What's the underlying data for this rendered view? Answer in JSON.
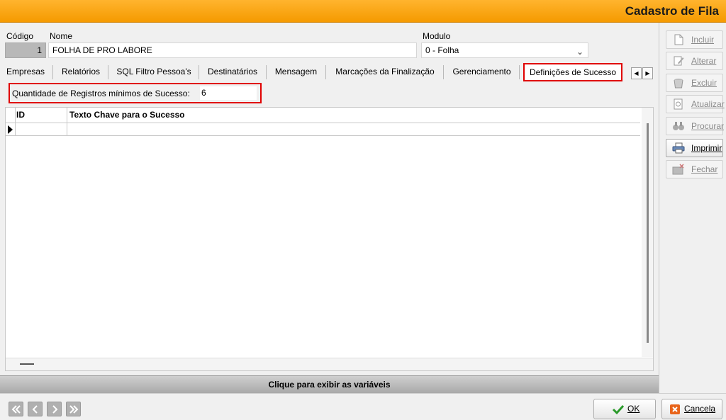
{
  "window": {
    "title": "Cadastro de Fila"
  },
  "form": {
    "codigo_label": "Código",
    "codigo_value": "1",
    "nome_label": "Nome",
    "nome_value": "FOLHA DE PRO LABORE",
    "modulo_label": "Modulo",
    "modulo_value": "0 - Folha"
  },
  "tabs": [
    {
      "label": "Empresas"
    },
    {
      "label": "Relatórios"
    },
    {
      "label": "SQL Filtro Pessoa's"
    },
    {
      "label": "Destinatários"
    },
    {
      "label": "Mensagem"
    },
    {
      "label": "Marcações da Finalização"
    },
    {
      "label": "Gerenciamento"
    },
    {
      "label": "Definições de Sucesso",
      "active": true
    }
  ],
  "success": {
    "qty_label": "Quantidade de Registros mínimos de Sucesso:",
    "qty_value": "6"
  },
  "grid": {
    "columns": [
      "ID",
      "Texto Chave para o Sucesso"
    ],
    "rows": []
  },
  "variables_bar": "Clique para exibir as variáveis",
  "sidebar": {
    "buttons": [
      {
        "label": "Incluir",
        "icon": "document-icon",
        "enabled": false
      },
      {
        "label": "Alterar",
        "icon": "edit-icon",
        "enabled": false
      },
      {
        "label": "Excluir",
        "icon": "trash-icon",
        "enabled": false
      },
      {
        "label": "Atualizar",
        "icon": "refresh-icon",
        "enabled": false
      },
      {
        "label": "Procurar",
        "icon": "binoculars-icon",
        "enabled": false
      },
      {
        "label": "Imprimir",
        "icon": "printer-icon",
        "enabled": true
      },
      {
        "label": "Fechar",
        "icon": "close-folder-icon",
        "enabled": false
      }
    ]
  },
  "footer": {
    "ok_label": "OK",
    "cancel_label": "Cancela",
    "nav_icons": [
      "first-icon",
      "prev-icon",
      "next-icon",
      "last-icon"
    ]
  },
  "colors": {
    "title_bar": "#f59a00",
    "highlight": "#e00000",
    "ok_check": "#2a9a2a",
    "cancel_icon": "#e8641a"
  }
}
